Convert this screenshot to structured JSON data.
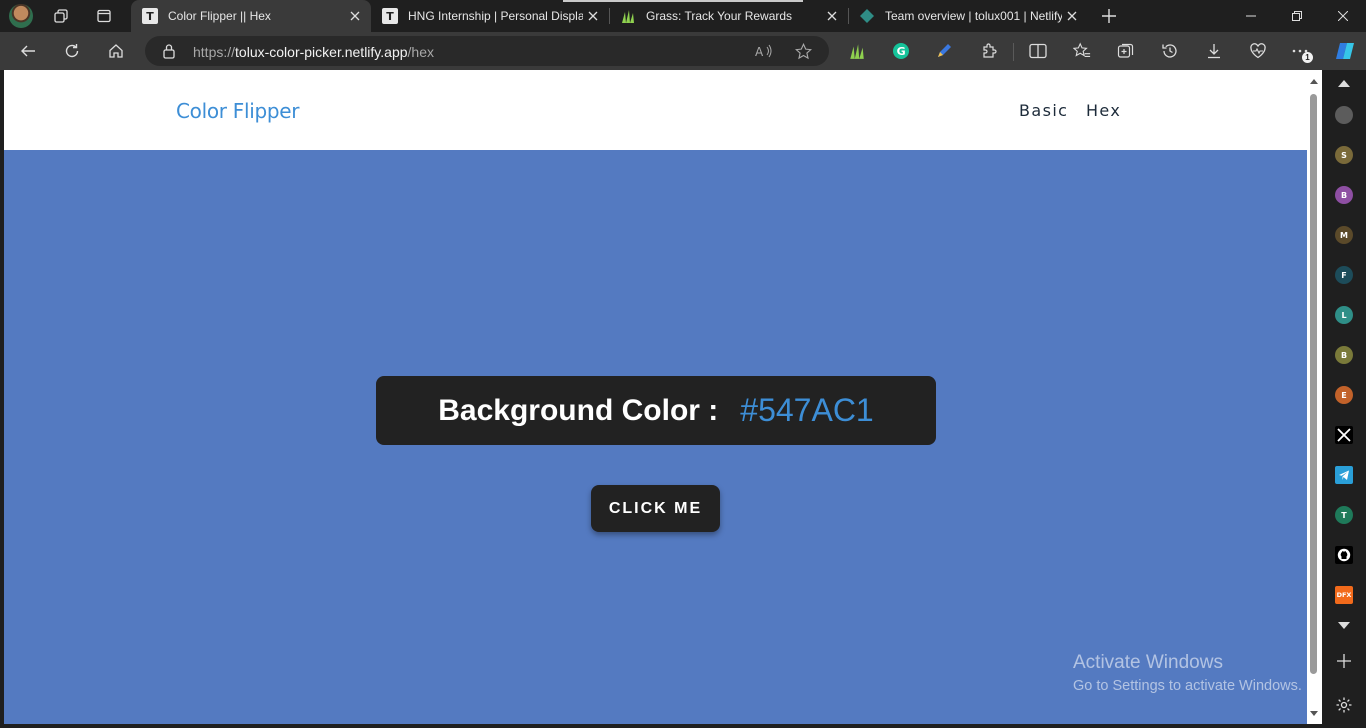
{
  "browser": {
    "tabs": [
      {
        "title": "Color Flipper || Hex",
        "favicon": "T",
        "active": true
      },
      {
        "title": "HNG Internship | Personal Display",
        "favicon": "T",
        "active": false
      },
      {
        "title": "Grass: Track Your Rewards",
        "favicon": "grass-icon",
        "active": false
      },
      {
        "title": "Team overview | tolux001 | Netlify",
        "favicon": "netlify-icon",
        "active": false
      }
    ],
    "address": {
      "scheme": "https://",
      "host": "tolux-color-picker.netlify.app",
      "path": "/hex"
    },
    "extension_badge": "1"
  },
  "page": {
    "brand": "Color Flipper",
    "nav": [
      "Basic",
      "Hex"
    ],
    "color_label": "Background Color :",
    "color_value": "#547AC1",
    "button_label": "CLICK ME",
    "background_color": "#547AC1"
  },
  "watermark": {
    "title": "Activate Windows",
    "subtitle": "Go to Settings to activate Windows."
  },
  "sidebar": {
    "items": [
      {
        "label": "",
        "color": "#5c5c5c"
      },
      {
        "label": "S",
        "color": "#7a6a3a"
      },
      {
        "label": "B",
        "color": "#8e4fa3"
      },
      {
        "label": "M",
        "color": "#5b4a2a"
      },
      {
        "label": "F",
        "color": "#1d4c5a"
      },
      {
        "label": "L",
        "color": "#2f8f88"
      },
      {
        "label": "B",
        "color": "#7a7a3a"
      },
      {
        "label": "E",
        "color": "#c2622a"
      },
      {
        "label": "",
        "color": "#000000",
        "icon": "x-icon"
      },
      {
        "label": "",
        "color": "#2a9fd8",
        "icon": "telegram-icon"
      },
      {
        "label": "T",
        "color": "#1f7a5a"
      },
      {
        "label": "",
        "color": "#000000",
        "icon": "github-icon"
      },
      {
        "label": "DFX",
        "color": "#f26a1b"
      }
    ]
  }
}
